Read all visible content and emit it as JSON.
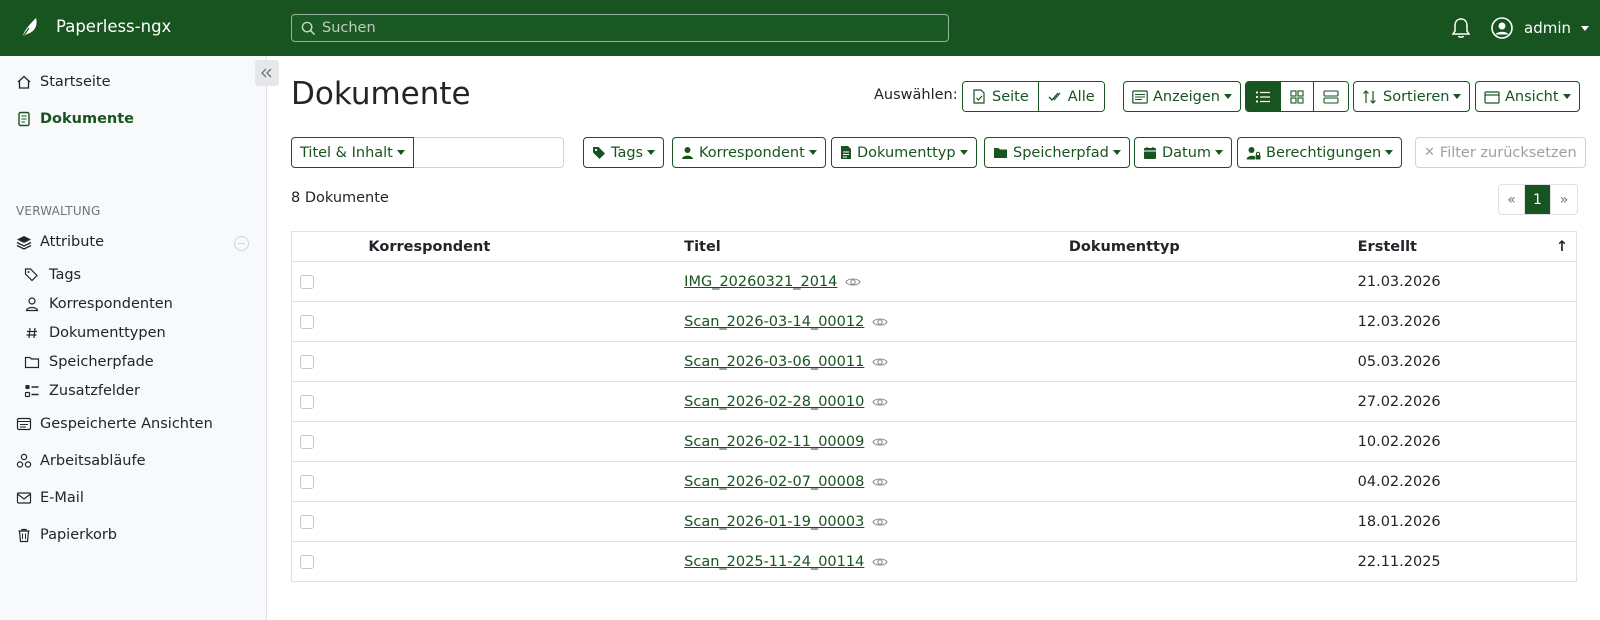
{
  "header": {
    "app_name": "Paperless-ngx",
    "search_placeholder": "Suchen",
    "user": "admin"
  },
  "sidebar": {
    "items": [
      {
        "label": "Startseite",
        "icon": "house-icon"
      },
      {
        "label": "Dokumente",
        "icon": "file-icon",
        "active": true
      }
    ],
    "section_title": "VERWALTUNG",
    "attributes": {
      "label": "Attribute",
      "icon": "layers-icon"
    },
    "sub_items": [
      {
        "label": "Tags",
        "icon": "tags-icon"
      },
      {
        "label": "Korrespondenten",
        "icon": "person-icon"
      },
      {
        "label": "Dokumenttypen",
        "icon": "hash-icon"
      },
      {
        "label": "Speicherpfade",
        "icon": "folder-icon"
      },
      {
        "label": "Zusatzfelder",
        "icon": "ui-checks-icon"
      }
    ],
    "bottom_items": [
      {
        "label": "Gespeicherte Ansichten",
        "icon": "saved-views-icon"
      },
      {
        "label": "Arbeitsabläufe",
        "icon": "workflow-icon"
      },
      {
        "label": "E-Mail",
        "icon": "envelope-icon"
      },
      {
        "label": "Papierkorb",
        "icon": "trash-icon"
      }
    ]
  },
  "main": {
    "title": "Dokumente",
    "select_label": "Auswählen:",
    "select_page": "Seite",
    "select_all": "Alle",
    "show_label": "Anzeigen",
    "sort_label": "Sortieren",
    "view_label": "Ansicht",
    "filters": {
      "title_content": "Titel & Inhalt",
      "tags": "Tags",
      "correspondent": "Korrespondent",
      "document_type": "Dokumenttyp",
      "storage_path": "Speicherpfad",
      "date": "Datum",
      "permissions": "Berechtigungen",
      "reset": "Filter zurücksetzen"
    },
    "doc_count": "8 Dokumente",
    "pagination": {
      "prev": "«",
      "page": "1",
      "next": "»"
    },
    "table": {
      "columns": [
        "Korrespondent",
        "Titel",
        "Dokumenttyp",
        "Erstellt"
      ],
      "sort_indicator": "↑",
      "rows": [
        {
          "correspondent": "",
          "title": "IMG_20260321_2014",
          "type": "",
          "created": "21.03.2026"
        },
        {
          "correspondent": "",
          "title": "Scan_2026-03-14_00012",
          "type": "",
          "created": "12.03.2026"
        },
        {
          "correspondent": "",
          "title": "Scan_2026-03-06_00011",
          "type": "",
          "created": "05.03.2026"
        },
        {
          "correspondent": "",
          "title": "Scan_2026-02-28_00010",
          "type": "",
          "created": "27.02.2026"
        },
        {
          "correspondent": "",
          "title": "Scan_2026-02-11_00009",
          "type": "",
          "created": "10.02.2026"
        },
        {
          "correspondent": "",
          "title": "Scan_2026-02-07_00008",
          "type": "",
          "created": "04.02.2026"
        },
        {
          "correspondent": "",
          "title": "Scan_2026-01-19_00003",
          "type": "",
          "created": "18.01.2026"
        },
        {
          "correspondent": "",
          "title": "Scan_2025-11-24_00114",
          "type": "",
          "created": "22.11.2025"
        }
      ]
    }
  },
  "colors": {
    "primary": "#17541f",
    "sidebar_bg": "#f8f9fa",
    "border": "#dee2e6"
  }
}
